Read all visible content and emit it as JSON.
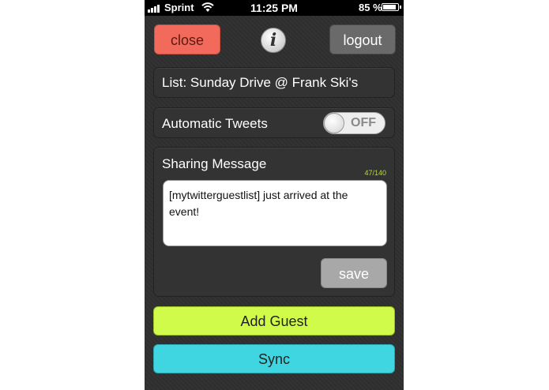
{
  "status_bar": {
    "carrier": "Sprint",
    "time": "11:25 PM",
    "battery_percent": "85 %",
    "battery_level": 0.85,
    "icons": [
      "signal-bars-icon",
      "wifi-icon",
      "battery-icon"
    ]
  },
  "header": {
    "close_label": "close",
    "info_glyph": "i",
    "logout_label": "logout"
  },
  "list": {
    "label": "List: Sunday Drive @ Frank Ski's"
  },
  "automatic_tweets": {
    "label": "Automatic Tweets",
    "toggle_state": "OFF"
  },
  "sharing": {
    "title": "Sharing Message",
    "char_count": "47/140",
    "message": "[mytwitterguestlist] just arrived at the event!",
    "save_label": "save"
  },
  "actions": {
    "add_guest_label": "Add Guest",
    "sync_label": "Sync"
  },
  "colors": {
    "close": "#f26a5b",
    "logout": "#6a6a6a",
    "add_guest": "#d1fb4b",
    "sync": "#40d6e1",
    "char_count": "#b8d94a"
  }
}
